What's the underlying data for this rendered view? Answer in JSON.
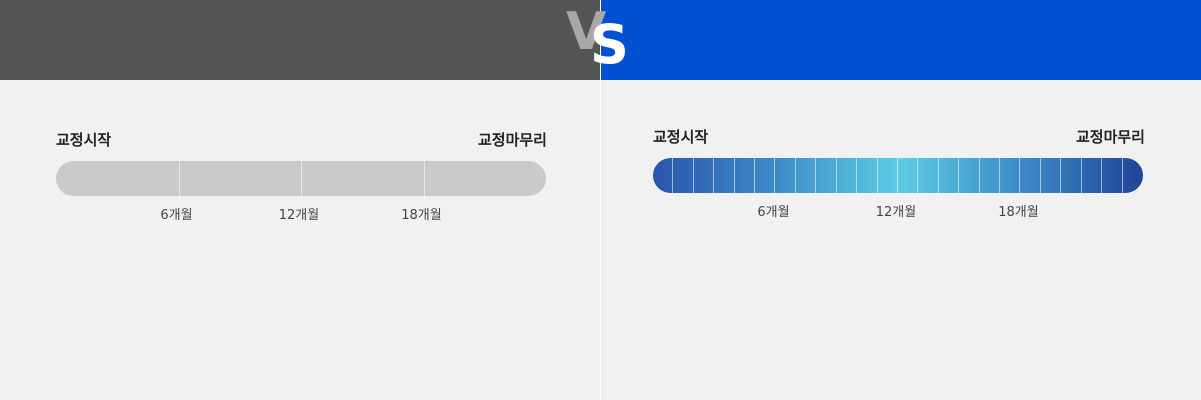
{
  "vs": {
    "v": "V",
    "s": "S"
  },
  "left": {
    "start_label": "교정시작",
    "end_label": "교정마무리",
    "markers": [
      {
        "label": "6개월",
        "position": 0.25
      },
      {
        "label": "12개월",
        "position": 0.5
      },
      {
        "label": "18개월",
        "position": 0.75
      }
    ],
    "bar_color": "#cacaca",
    "header_color": "#555555"
  },
  "right": {
    "start_label": "교정시작",
    "end_label": "교정마무리",
    "markers": [
      {
        "label": "6개월",
        "position": 0.25
      },
      {
        "label": "12개월",
        "position": 0.5
      },
      {
        "label": "18개월",
        "position": 0.75
      }
    ],
    "segment_count": 24,
    "gradient_colors": [
      "#2a55ad",
      "#3d8bc9",
      "#5ccde4",
      "#3d8bc9",
      "#1f4596"
    ],
    "header_color": "#0050d2"
  }
}
